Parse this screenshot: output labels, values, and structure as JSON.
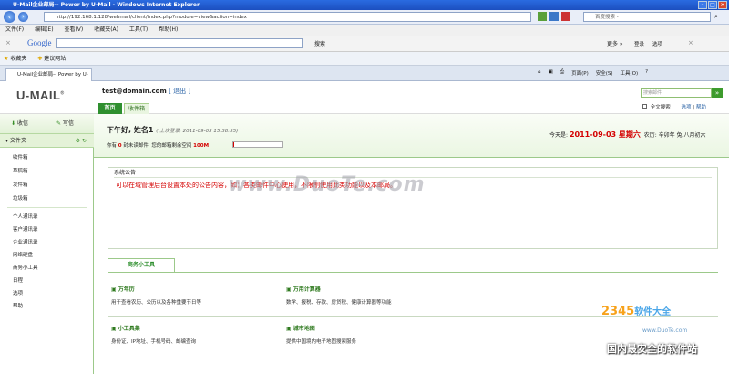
{
  "browser": {
    "window_title": "U-Mail企业邮局-- Power by U-Mail - Windows Internet Explorer",
    "url": "http://192.168.1.128/webmail/client/index.php?module=view&action=index",
    "search_placeholder": "百度搜索 -",
    "menu": [
      "文件(F)",
      "编辑(E)",
      "查看(V)",
      "收藏夹(A)",
      "工具(T)",
      "帮助(H)"
    ],
    "google_label": "Google",
    "google_search": "搜索",
    "more_label": "更多 »",
    "login_label": "登录",
    "options_label": "选项",
    "favorites_label": "收藏夹",
    "suggested_label": "建议网站",
    "tab_title": "U-Mail企业邮局-- Power by U-Mail",
    "toolbar_right": [
      "页面(P)",
      "安全(S)",
      "工具(O)"
    ]
  },
  "header": {
    "logo": "U-MAIL",
    "user": "test@domain.com",
    "logout": "[ 退出 ]",
    "tabs": [
      "首页",
      "收件箱"
    ],
    "search_placeholder": "搜索邮件",
    "fulltext": "全文搜索",
    "options": "选项",
    "help": "帮助"
  },
  "sidebar": {
    "receive": "收信",
    "write": "写信",
    "folders_label": "文件夹",
    "folders": [
      "收件箱",
      "草稿箱",
      "发件箱",
      "垃圾箱"
    ],
    "tools": [
      "个人通讯录",
      "客户通讯录",
      "企业通讯录",
      "网络硬盘",
      "商务小工具",
      "日程",
      "选项",
      "帮助"
    ]
  },
  "greeting": {
    "hello": "下午好, 姓名1",
    "last_login": "( 上次登录: 2011-09-03 15:38:55)",
    "unread_prefix": "你有",
    "unread_count": "0",
    "unread_suffix": "封未读邮件",
    "space_prefix": "您的邮箱剩余空间",
    "space_value": "100M",
    "today_prefix": "今天是:",
    "today_date": "2011-09-03 星期六",
    "lunar": "农历: 辛卯年 兔 八月初六",
    "quota_used_fraction": 0.02
  },
  "announcement": {
    "title": "系统公告",
    "text": "可以在域管理后台设置本处的公告内容，如：各类邮件中心使用，不限制使用此类功能以及本邮局。"
  },
  "tools_box": {
    "tab": "商务小工具",
    "items": [
      {
        "name": "万年历",
        "desc": "用于查看农历、公历以及各种重要节日等"
      },
      {
        "name": "万用计算器",
        "desc": "数学、报税、存款、房贷税、健康计算器等功能"
      },
      {
        "name": "小工具集",
        "desc": "身份证、IP地址、手机号码、邮编查询"
      },
      {
        "name": "城市地图",
        "desc": "提供中国境内电子地图搜索服务"
      }
    ]
  },
  "watermark": {
    "duote": "www.DuoTe.com",
    "brand_num": "2345",
    "brand_text": "软件大全",
    "brand_url": "www.DuoTe.com",
    "slogan": "国内最安全的软件站"
  }
}
